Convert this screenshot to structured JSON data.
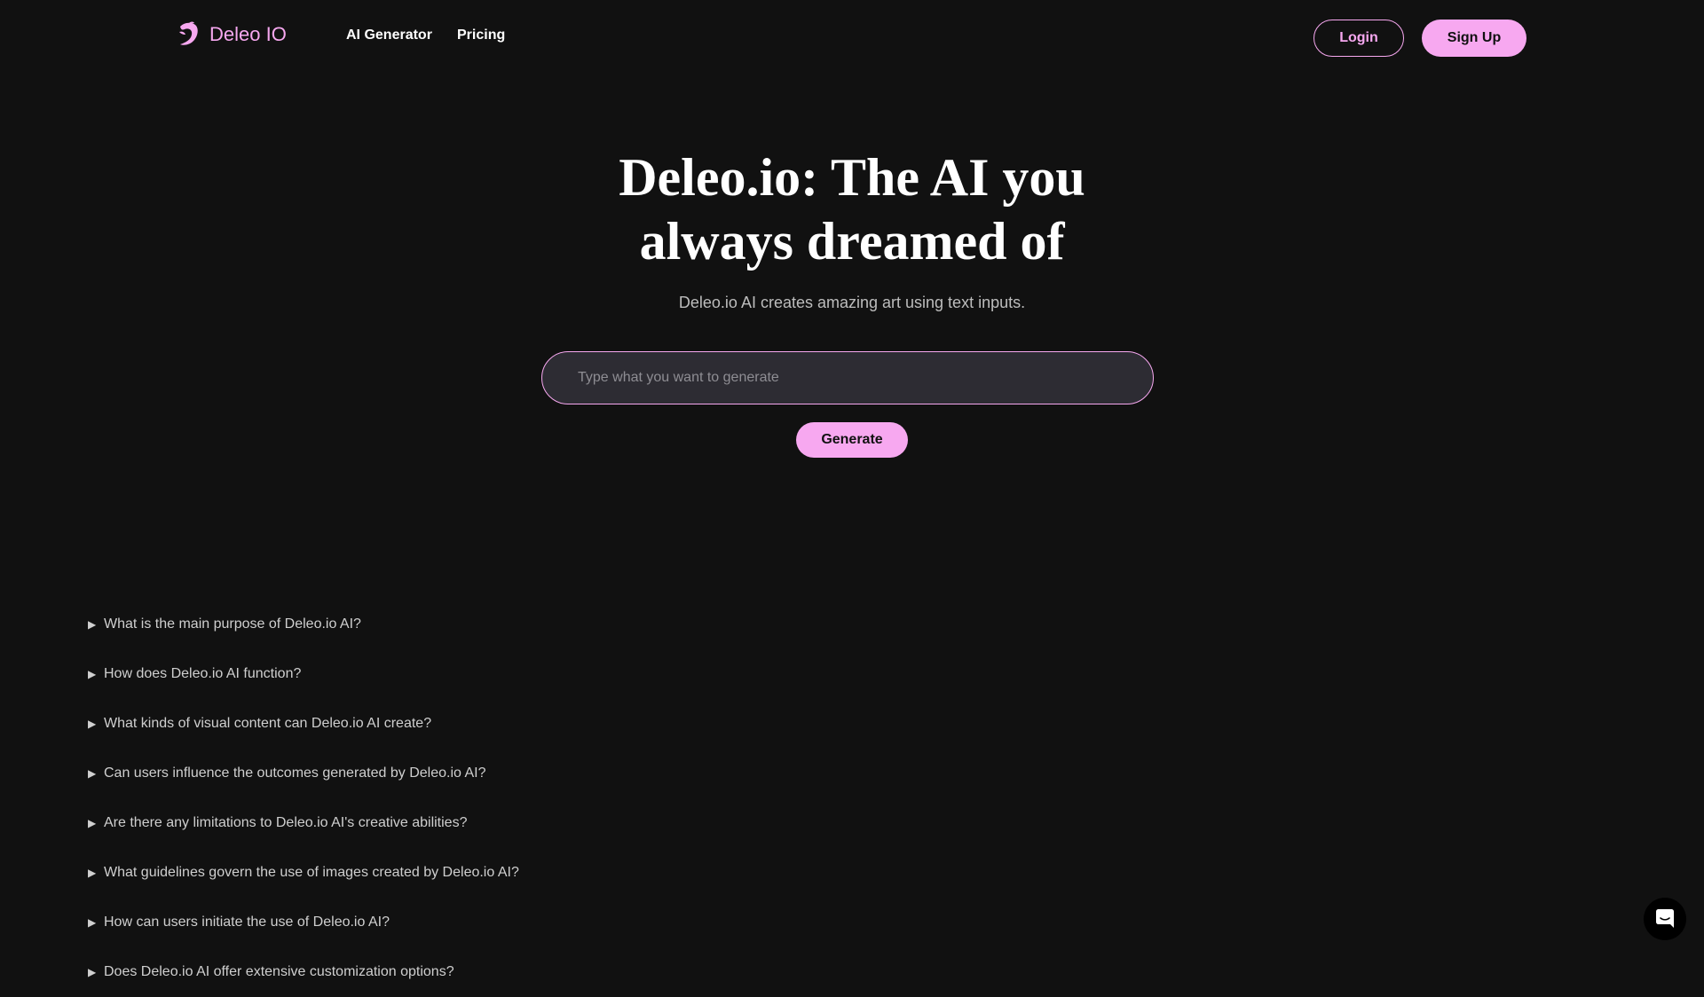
{
  "brand": {
    "name": "Deleo IO",
    "accent_color": "#f7a8f0",
    "background_color": "#111111"
  },
  "nav": {
    "links": [
      {
        "label": "AI Generator"
      },
      {
        "label": "Pricing"
      }
    ],
    "login_label": "Login",
    "signup_label": "Sign Up"
  },
  "hero": {
    "title_line1": "Deleo.io: The AI you",
    "title_line2": "always dreamed of",
    "subtitle": "Deleo.io AI creates amazing art using text inputs.",
    "input_placeholder": "Type what you want to generate",
    "input_value": "",
    "generate_label": "Generate"
  },
  "faq": {
    "items": [
      {
        "question": "What is the main purpose of Deleo.io AI?"
      },
      {
        "question": "How does Deleo.io AI function?"
      },
      {
        "question": "What kinds of visual content can Deleo.io AI create?"
      },
      {
        "question": "Can users influence the outcomes generated by Deleo.io AI?"
      },
      {
        "question": "Are there any limitations to Deleo.io AI's creative abilities?"
      },
      {
        "question": "What guidelines govern the use of images created by Deleo.io AI?"
      },
      {
        "question": "How can users initiate the use of Deleo.io AI?"
      },
      {
        "question": "Does Deleo.io AI offer extensive customization options?"
      }
    ],
    "collapsed_icon": "triangle-right-icon"
  },
  "chat_widget": {
    "icon": "chat-bubble-icon"
  }
}
